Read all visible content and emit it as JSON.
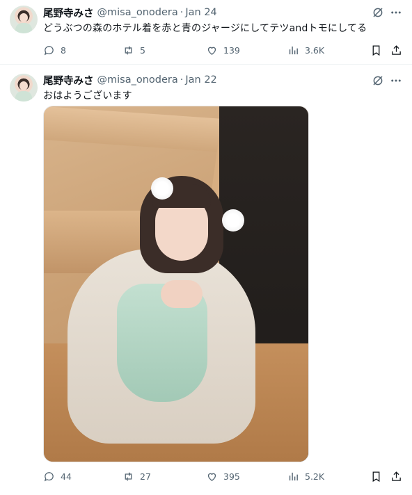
{
  "tweets": [
    {
      "author_name": "尾野寺みさ",
      "handle": "@misa_onodera",
      "separator": "·",
      "date": "Jan 24",
      "text": "どうぶつの森のホテル着を赤と青のジャージにしてテツandトモにしてる",
      "replies": "8",
      "reposts": "5",
      "likes": "139",
      "views": "3.6K"
    },
    {
      "author_name": "尾野寺みさ",
      "handle": "@misa_onodera",
      "separator": "·",
      "date": "Jan 22",
      "text": "おはようございます",
      "replies": "44",
      "reposts": "27",
      "likes": "395",
      "views": "5.2K"
    }
  ],
  "icons": {
    "grok": "grok-icon",
    "more": "more-icon",
    "reply": "reply-icon",
    "repost": "repost-icon",
    "like": "like-icon",
    "views": "views-icon",
    "bookmark": "bookmark-icon",
    "share": "share-icon"
  },
  "colors": {
    "text": "#0f1419",
    "secondary": "#536471",
    "divider": "#eff3f4"
  }
}
